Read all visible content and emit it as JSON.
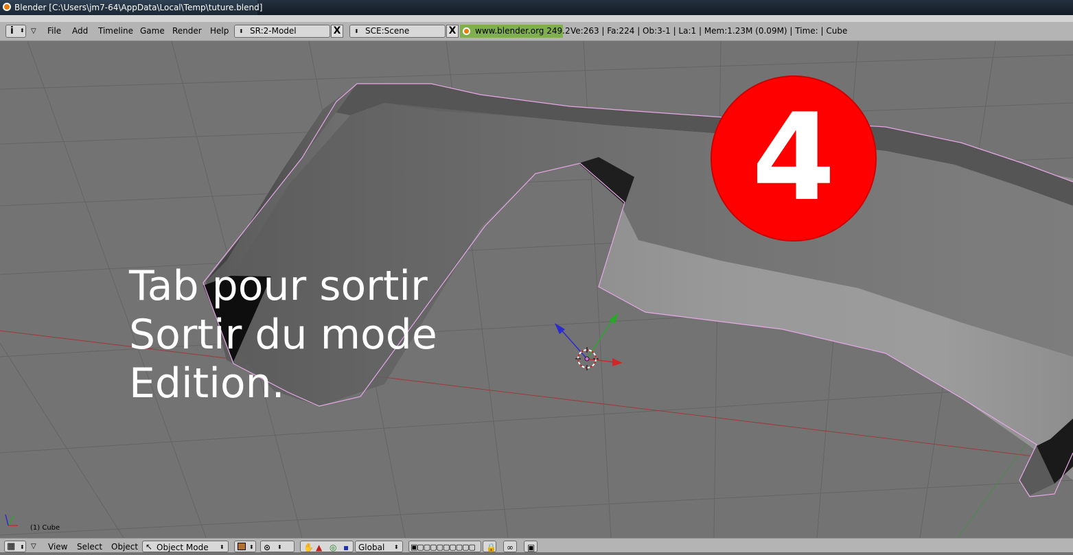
{
  "window": {
    "title": "Blender [C:\\Users\\jm7-64\\AppData\\Local\\Temp\\tuture.blend]"
  },
  "header": {
    "menus": [
      "File",
      "Add",
      "Timeline",
      "Game",
      "Render",
      "Help"
    ],
    "screen_field": "SR:2-Model",
    "scene_field": "SCE:Scene",
    "close_glyph": "X",
    "website": "www.blender.org 249.2",
    "stats": "Ve:263 | Fa:224 | Ob:3-1 | La:1  | Mem:1.23M (0.09M)  | Time: | Cube"
  },
  "viewport": {
    "object_label": "(1) Cube",
    "overlay_lines": [
      "Tab pour sortir",
      "Sortir du mode",
      "Edition."
    ],
    "step_badge": "4"
  },
  "footer": {
    "menus": [
      "View",
      "Select",
      "Object"
    ],
    "mode": "Object Mode",
    "orientation": "Global"
  },
  "colors": {
    "badge": "#ff0000",
    "selection_outline": "#e8a8e8",
    "header_bg": "#b4b4b4",
    "viewport_bg": "#737373"
  }
}
